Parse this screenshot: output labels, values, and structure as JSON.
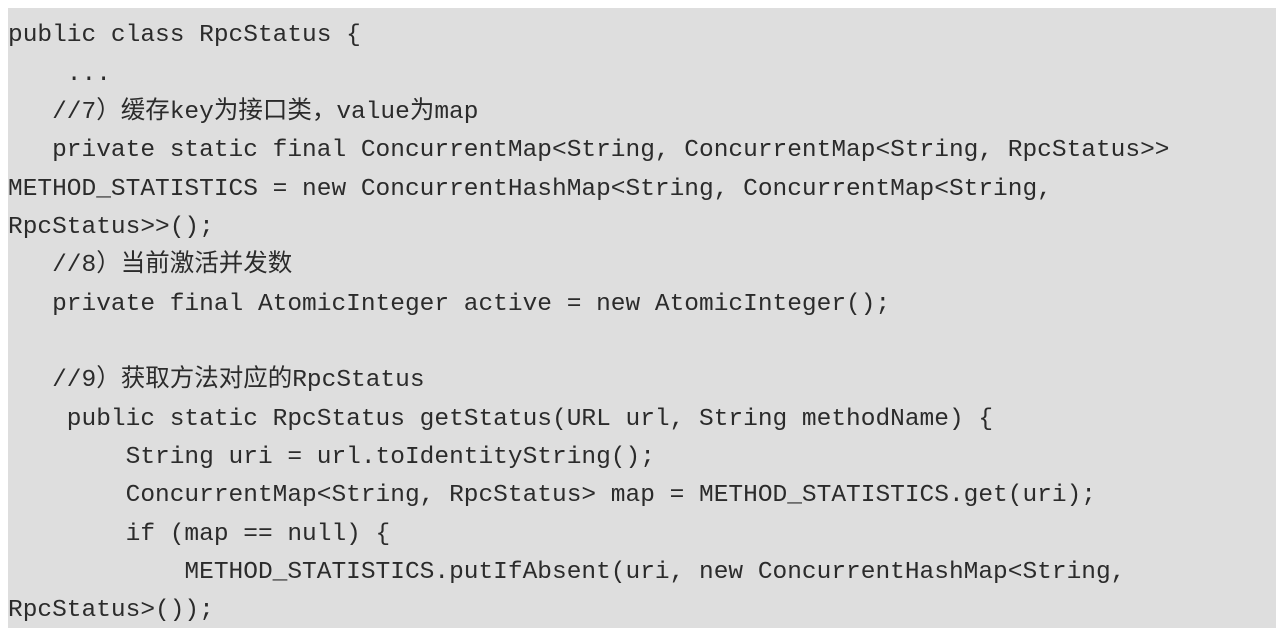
{
  "code": {
    "lines": [
      "public class RpcStatus {",
      "    ...",
      "   //7）缓存key为接口类，value为map",
      "   private static final ConcurrentMap<String, ConcurrentMap<String, RpcStatus>>",
      "METHOD_STATISTICS = new ConcurrentHashMap<String, ConcurrentMap<String,",
      "RpcStatus>>();",
      "   //8）当前激活并发数",
      "   private final AtomicInteger active = new AtomicInteger();",
      "",
      "   //9）获取方法对应的RpcStatus",
      "    public static RpcStatus getStatus(URL url, String methodName) {",
      "        String uri = url.toIdentityString();",
      "        ConcurrentMap<String, RpcStatus> map = METHOD_STATISTICS.get(uri);",
      "        if (map == null) {",
      "            METHOD_STATISTICS.putIfAbsent(uri, new ConcurrentHashMap<String,",
      "RpcStatus>());"
    ]
  }
}
